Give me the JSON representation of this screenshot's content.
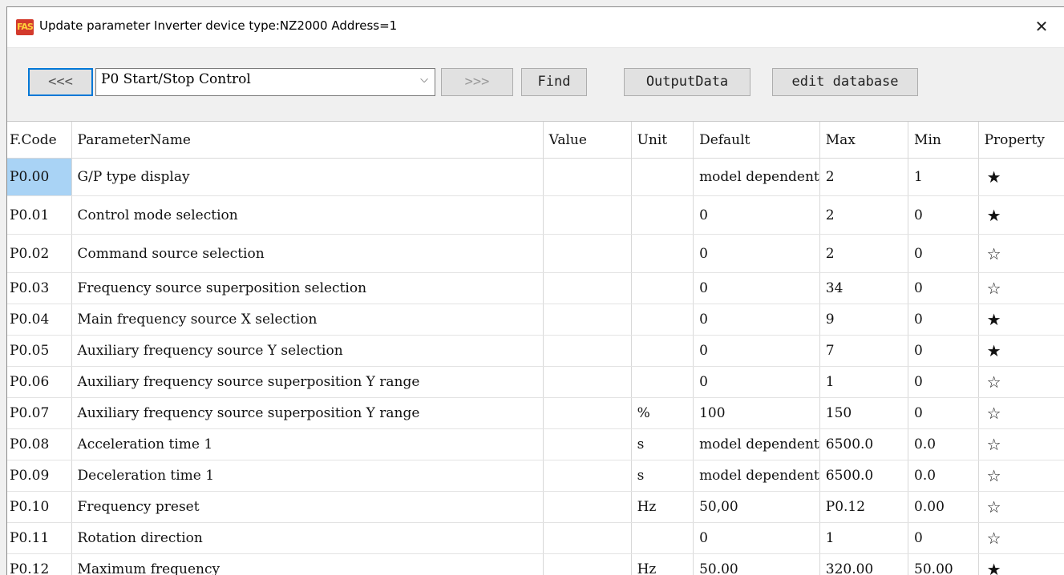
{
  "window": {
    "title": "Update parameter Inverter device type:NZ2000  Address=1",
    "app_icon_text": "FAS",
    "close_glyph": "✕"
  },
  "toolbar": {
    "prev_label": "<<<",
    "group_value": "P0 Start/Stop Control",
    "next_label": ">>>",
    "find_label": "Find",
    "output_label": "OutputData",
    "edit_label": "edit database"
  },
  "table": {
    "columns": [
      "F.Code",
      "ParameterName",
      "Value",
      "Unit",
      "Default",
      "Max",
      "Min",
      "Property"
    ],
    "rows": [
      {
        "code": "P0.00",
        "name": "G/P type display",
        "value": "",
        "unit": "",
        "default": "model dependent",
        "max": "2",
        "min": "1",
        "prop": "★"
      },
      {
        "code": "P0.01",
        "name": "Control mode selection",
        "value": "",
        "unit": "",
        "default": "0",
        "max": "2",
        "min": "0",
        "prop": "★"
      },
      {
        "code": "P0.02",
        "name": "Command source selection",
        "value": "",
        "unit": "",
        "default": "0",
        "max": "2",
        "min": "0",
        "prop": "☆"
      },
      {
        "code": "P0.03",
        "name": "Frequency source superposition selection",
        "value": "",
        "unit": "",
        "default": "0",
        "max": "34",
        "min": "0",
        "prop": "☆"
      },
      {
        "code": "P0.04",
        "name": "Main frequency source X selection",
        "value": "",
        "unit": "",
        "default": "0",
        "max": "9",
        "min": "0",
        "prop": "★"
      },
      {
        "code": "P0.05",
        "name": "Auxiliary frequency source Y selection",
        "value": "",
        "unit": "",
        "default": "0",
        "max": "7",
        "min": "0",
        "prop": "★"
      },
      {
        "code": "P0.06",
        "name": "Auxiliary frequency source superposition Y range",
        "value": "",
        "unit": "",
        "default": "0",
        "max": "1",
        "min": "0",
        "prop": "☆"
      },
      {
        "code": "P0.07",
        "name": "Auxiliary frequency source superposition Y range",
        "value": "",
        "unit": "%",
        "default": "100",
        "max": "150",
        "min": "0",
        "prop": "☆"
      },
      {
        "code": "P0.08",
        "name": "Acceleration time 1",
        "value": "",
        "unit": "s",
        "default": "model dependent",
        "max": "6500.0",
        "min": "0.0",
        "prop": "☆"
      },
      {
        "code": "P0.09",
        "name": "Deceleration time 1",
        "value": "",
        "unit": "s",
        "default": "model dependent",
        "max": "6500.0",
        "min": "0.0",
        "prop": "☆"
      },
      {
        "code": "P0.10",
        "name": "Frequency preset",
        "value": "",
        "unit": "Hz",
        "default": "50,00",
        "max": "P0.12",
        "min": "0.00",
        "prop": "☆"
      },
      {
        "code": "P0.11",
        "name": "Rotation direction",
        "value": "",
        "unit": "",
        "default": "0",
        "max": "1",
        "min": "0",
        "prop": "☆"
      },
      {
        "code": "P0.12",
        "name": "Maximum frequency",
        "value": "",
        "unit": "Hz",
        "default": "50.00",
        "max": "320.00",
        "min": "50.00",
        "prop": "★"
      }
    ]
  },
  "colors": {
    "selection": "#a9d3f5",
    "focus_border": "#0078d7"
  }
}
